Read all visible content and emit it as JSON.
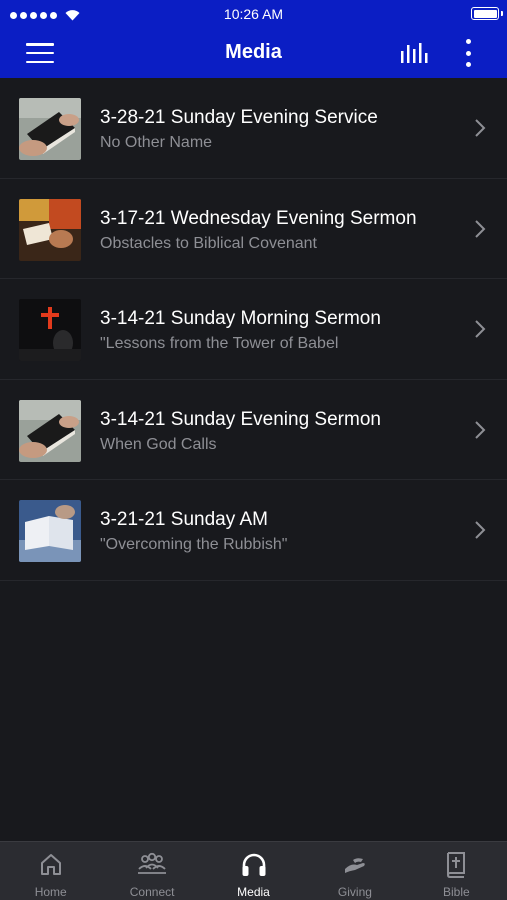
{
  "status_bar": {
    "time": "10:26 AM"
  },
  "header": {
    "title": "Media"
  },
  "media_items": [
    {
      "title": "3-28-21 Sunday Evening Service",
      "subtitle": "No Other Name"
    },
    {
      "title": "3-17-21 Wednesday Evening Sermon",
      "subtitle": "Obstacles to Biblical Covenant"
    },
    {
      "title": "3-14-21 Sunday Morning Sermon",
      "subtitle": "\"Lessons from the Tower of Babel"
    },
    {
      "title": "3-14-21 Sunday Evening Sermon",
      "subtitle": "When God Calls"
    },
    {
      "title": "3-21-21 Sunday AM",
      "subtitle": "\"Overcoming the Rubbish\""
    }
  ],
  "tabs": [
    {
      "label": "Home",
      "icon": "home-icon",
      "active": false
    },
    {
      "label": "Connect",
      "icon": "people-icon",
      "active": false
    },
    {
      "label": "Media",
      "icon": "headphones-icon",
      "active": true
    },
    {
      "label": "Giving",
      "icon": "giving-hand-icon",
      "active": false
    },
    {
      "label": "Bible",
      "icon": "bible-icon",
      "active": false
    }
  ],
  "colors": {
    "primary": "#0b1ec4",
    "background": "#18191d",
    "tab_bar": "#2b2c31",
    "muted_text": "#8e8f95"
  }
}
